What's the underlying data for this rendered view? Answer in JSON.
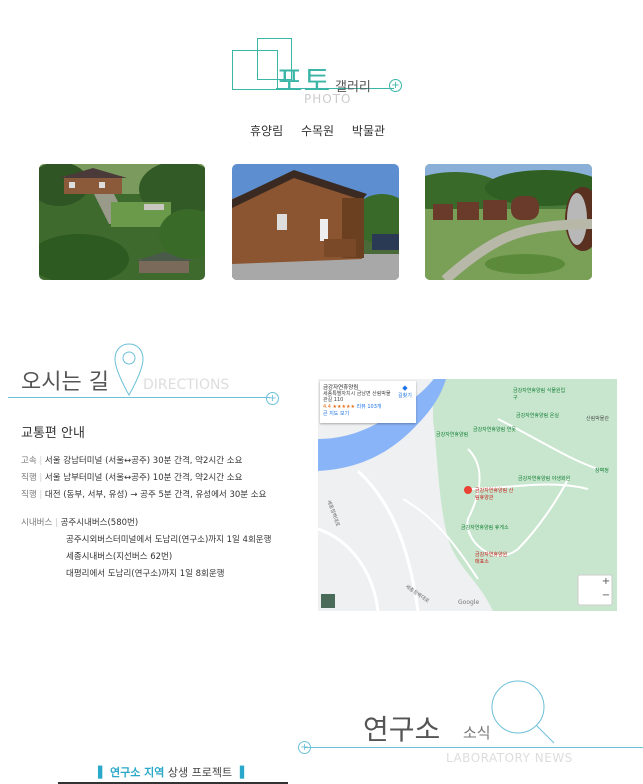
{
  "photo": {
    "title": "포토",
    "subtitle": "갤러리",
    "en": "PHOTO",
    "tabs": [
      "휴양림",
      "수목원",
      "박물관"
    ]
  },
  "directions": {
    "title": "오시는 길",
    "en": "DIRECTIONS",
    "traffic_heading": "교통편 안내",
    "rows": [
      {
        "label": "고속",
        "text": "서울 강남터미널 (서울↔공주) 30분 간격, 약2시간 소요"
      },
      {
        "label": "직행",
        "text": "서울 남부터미널 (서울↔공주) 10분 간격, 약2시간 소요"
      },
      {
        "label": "직행",
        "text": "대전 (동부, 서부, 유성) → 공주 5분 간격, 유성에서 30분 소요"
      }
    ],
    "city_bus": {
      "label": "시내버스",
      "lines": [
        "공주시내버스(580번)",
        "공주시외버스터미널에서 도남리(연구소)까지 1일 4회운행",
        "세종시내버스(지선버스 62번)",
        "대평리에서 도남리(연구소)까지 1일 8회운행"
      ]
    }
  },
  "map": {
    "card_title": "금강자연휴양림",
    "card_addr": "세종특별자치시 금남면 산림박물관길 110",
    "card_rating": "4.4 ★★★★★",
    "card_reviews": "리뷰 103개",
    "card_link": "큰 지도 보기",
    "card_dir": "길찾기",
    "labels": [
      "금강자연휴양림 식물원입구",
      "금강자연휴양림 온실",
      "산림박물관",
      "금강자연휴양림",
      "금강자연휴양림 연못",
      "금강자연휴양림 야생화원",
      "금강자연휴양림 산림휴양관",
      "창벽정",
      "금강자연휴양림 휴게소",
      "세종청벽대로",
      "세종청벽대로",
      "금강자연휴양원 매표소"
    ],
    "google": "Google",
    "zoom_in": "+",
    "zoom_out": "−"
  },
  "lab": {
    "title": "연구소",
    "sub": "소식",
    "en": "LABORATORY NEWS",
    "region_highlight": "연구소 지역",
    "region_rest": "상생 프로젝트"
  }
}
